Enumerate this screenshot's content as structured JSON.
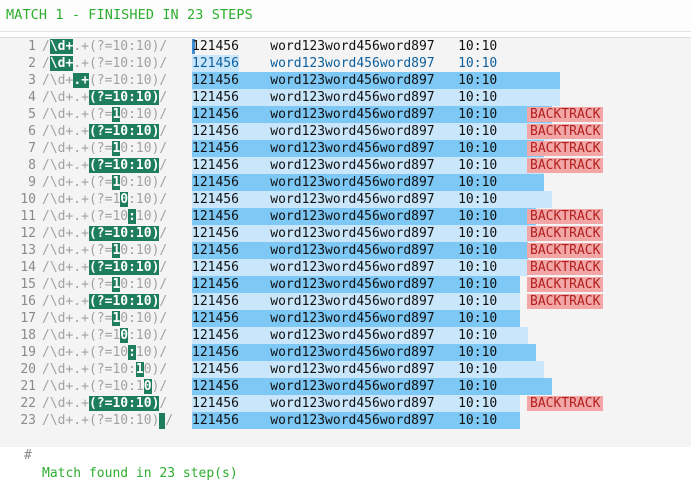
{
  "header": {
    "title": "MATCH 1 - FINISHED IN 23 STEPS"
  },
  "subject_parts": {
    "a": "121456",
    "gap1": "    ",
    "b": "word123word456word897",
    "gap2": "   ",
    "c": "10:10"
  },
  "backtrack_label": "BACKTRACK",
  "footer": {
    "hash": "#",
    "message": "Match found in 23 step(s)"
  },
  "steps": [
    {
      "n": "1",
      "pre": "/",
      "act": "\\d+",
      "post": ".+(?=10:10)/",
      "cursor": false,
      "match_len": 0,
      "backtrack": false
    },
    {
      "n": "2",
      "pre": "/",
      "act": "\\d+",
      "post": ".+(?=10:10)/",
      "cursor": false,
      "match_len": 6,
      "backtrack": false
    },
    {
      "n": "3",
      "pre": "/\\d+",
      "act": ".+",
      "post": "(?=10:10)/",
      "cursor": false,
      "match_len": 47,
      "backtrack": false
    },
    {
      "n": "4",
      "pre": "/\\d+.+",
      "act": "(?=10:10)",
      "post": "/",
      "cursor": false,
      "match_len": 47,
      "backtrack": false
    },
    {
      "n": "5",
      "pre": "/\\d+.+(?=",
      "act": "1",
      "post": "0:10)/",
      "cursor": false,
      "match_len": 46,
      "backtrack": true
    },
    {
      "n": "6",
      "pre": "/\\d+.+",
      "act": "(?=10:10)",
      "post": "/",
      "cursor": false,
      "match_len": 46,
      "backtrack": true
    },
    {
      "n": "7",
      "pre": "/\\d+.+(?=",
      "act": "1",
      "post": "0:10)/",
      "cursor": false,
      "match_len": 45,
      "backtrack": true
    },
    {
      "n": "8",
      "pre": "/\\d+.+",
      "act": "(?=10:10)",
      "post": "/",
      "cursor": false,
      "match_len": 45,
      "backtrack": true
    },
    {
      "n": "9",
      "pre": "/\\d+.+(?=",
      "act": "1",
      "post": "0:10)/",
      "cursor": false,
      "match_len": 45,
      "backtrack": false
    },
    {
      "n": "10",
      "pre": "/\\d+.+(?=1",
      "act": "0",
      "post": ":10)/",
      "cursor": false,
      "match_len": 46,
      "backtrack": false
    },
    {
      "n": "11",
      "pre": "/\\d+.+(?=10",
      "act": ":",
      "post": "10)/",
      "cursor": false,
      "match_len": 44,
      "backtrack": true
    },
    {
      "n": "12",
      "pre": "/\\d+.+",
      "act": "(?=10:10)",
      "post": "/",
      "cursor": false,
      "match_len": 44,
      "backtrack": true
    },
    {
      "n": "13",
      "pre": "/\\d+.+(?=",
      "act": "1",
      "post": "0:10)/",
      "cursor": false,
      "match_len": 43,
      "backtrack": true
    },
    {
      "n": "14",
      "pre": "/\\d+.+",
      "act": "(?=10:10)",
      "post": "/",
      "cursor": false,
      "match_len": 43,
      "backtrack": true
    },
    {
      "n": "15",
      "pre": "/\\d+.+(?=",
      "act": "1",
      "post": "0:10)/",
      "cursor": false,
      "match_len": 42,
      "backtrack": true
    },
    {
      "n": "16",
      "pre": "/\\d+.+",
      "act": "(?=10:10)",
      "post": "/",
      "cursor": false,
      "match_len": 42,
      "backtrack": true
    },
    {
      "n": "17",
      "pre": "/\\d+.+(?=",
      "act": "1",
      "post": "0:10)/",
      "cursor": false,
      "match_len": 42,
      "backtrack": false
    },
    {
      "n": "18",
      "pre": "/\\d+.+(?=1",
      "act": "0",
      "post": ":10)/",
      "cursor": false,
      "match_len": 43,
      "backtrack": false
    },
    {
      "n": "19",
      "pre": "/\\d+.+(?=10",
      "act": ":",
      "post": "10)/",
      "cursor": false,
      "match_len": 44,
      "backtrack": false
    },
    {
      "n": "20",
      "pre": "/\\d+.+(?=10:",
      "act": "1",
      "post": "0)/",
      "cursor": false,
      "match_len": 45,
      "backtrack": false
    },
    {
      "n": "21",
      "pre": "/\\d+.+(?=10:1",
      "act": "0",
      "post": ")/",
      "cursor": false,
      "match_len": 46,
      "backtrack": false
    },
    {
      "n": "22",
      "pre": "/\\d+.+",
      "act": "(?=10:10)",
      "post": "/",
      "cursor": false,
      "match_len": 42,
      "backtrack": true
    },
    {
      "n": "23",
      "pre": "/\\d+.+(?=10:10)",
      "act": "",
      "post": "/",
      "cursor": true,
      "match_len": 42,
      "backtrack": false
    }
  ],
  "colors": {
    "match_primary": "#7ec8f5",
    "match_secondary": "#c9e6fb",
    "active_token": "#1e7d5c",
    "header_text": "#2eae2e",
    "backtrack_bg": "#f3a6a6"
  }
}
